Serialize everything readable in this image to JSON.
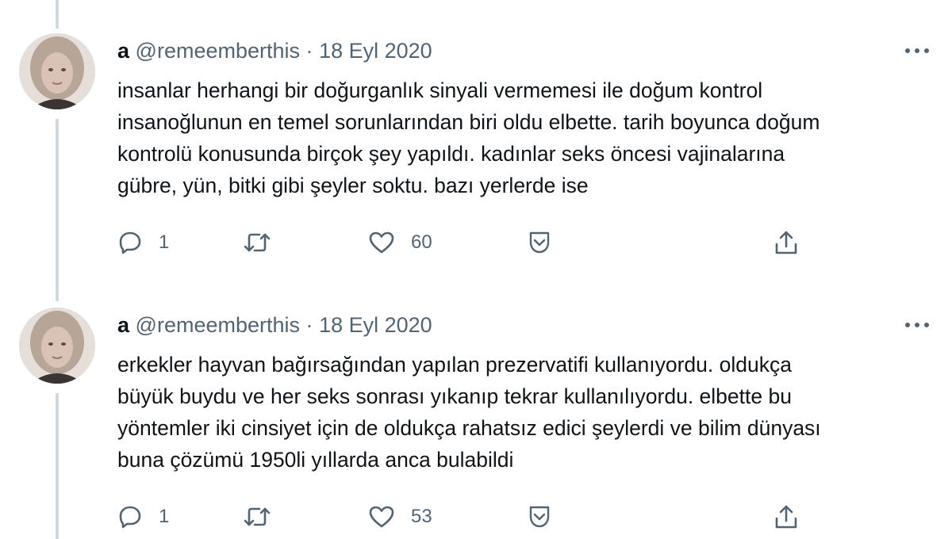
{
  "tweets": [
    {
      "display_name": "a",
      "handle": "@remeemberthis",
      "separator": "·",
      "date": "18 Eyl 2020",
      "text": "insanlar herhangi bir doğurganlık sinyali vermemesi ile doğum kontrol\ninsanoğlunun en temel sorunlarından biri oldu elbette. tarih boyunca doğum\nkontrolü konusunda birçok şey yapıldı. kadınlar seks öncesi vajinalarına\ngübre, yün, bitki gibi şeyler soktu. bazı yerlerde ise",
      "reply_count": "1",
      "like_count": "60"
    },
    {
      "display_name": "a",
      "handle": "@remeemberthis",
      "separator": "·",
      "date": "18 Eyl 2020",
      "text": "erkekler hayvan bağırsağından yapılan prezervatifi kullanıyordu. oldukça\nbüyük buydu ve her seks sonrası yıkanıp tekrar kullanılıyordu. elbette bu\nyöntemler iki cinsiyet için de oldukça rahatsız edici şeylerdi ve bilim dünyası\nbuna çözümü 1950li yıllarda anca bulabildi",
      "reply_count": "1",
      "like_count": "53"
    }
  ],
  "icons": {
    "reply": "reply-icon",
    "retweet": "retweet-icon",
    "like": "heart-icon",
    "save": "bookmark-icon",
    "share": "share-icon",
    "more": "more-icon"
  },
  "colors": {
    "text_primary": "#0f1419",
    "text_secondary": "#536471",
    "thread_line": "#cfd9de"
  }
}
